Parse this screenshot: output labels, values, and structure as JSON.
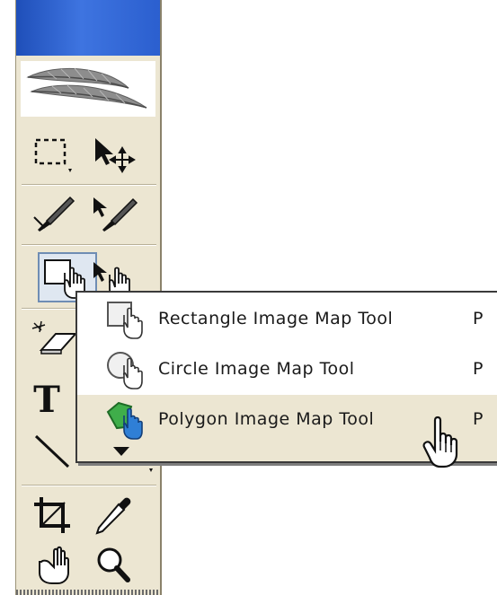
{
  "toolbox": {
    "tools": [
      {
        "name": "marquee-tool",
        "icon": "marquee-icon"
      },
      {
        "name": "pointer-move-tool",
        "icon": "pointer-move-icon"
      },
      {
        "name": "slice-tool",
        "icon": "slice-knife-icon"
      },
      {
        "name": "slice-select-tool",
        "icon": "slice-select-icon"
      },
      {
        "name": "image-map-tool",
        "icon": "image-map-hand-icon"
      },
      {
        "name": "image-map-select-tool",
        "icon": "image-map-select-icon"
      },
      {
        "name": "eraser-tool",
        "icon": "eraser-icon"
      },
      {
        "name": "type-tool",
        "icon": "type-icon"
      },
      {
        "name": "line-tool",
        "icon": "line-icon"
      },
      {
        "name": "crop-tool",
        "icon": "crop-icon"
      },
      {
        "name": "eyedropper-tool",
        "icon": "eyedropper-icon"
      },
      {
        "name": "hand-tool",
        "icon": "hand-icon"
      },
      {
        "name": "zoom-tool",
        "icon": "magnifier-icon"
      }
    ],
    "type_glyph": "T"
  },
  "flyout": {
    "items": [
      {
        "label": "Rectangle Image Map Tool",
        "shortcut": "P",
        "icon": "rectangle-image-map-icon"
      },
      {
        "label": "Circle Image Map Tool",
        "shortcut": "P",
        "icon": "circle-image-map-icon"
      },
      {
        "label": "Polygon Image Map Tool",
        "shortcut": "P",
        "icon": "polygon-image-map-icon",
        "highlighted": true
      }
    ],
    "more_indicator": "triangle-down-icon"
  },
  "colors": {
    "titlebar": "#2b5fcf",
    "panel": "#ece6d2",
    "selection_border": "#6f8db4",
    "polygon_icon_green": "#3fae4a",
    "hand_icon_blue": "#2f7fd6"
  }
}
